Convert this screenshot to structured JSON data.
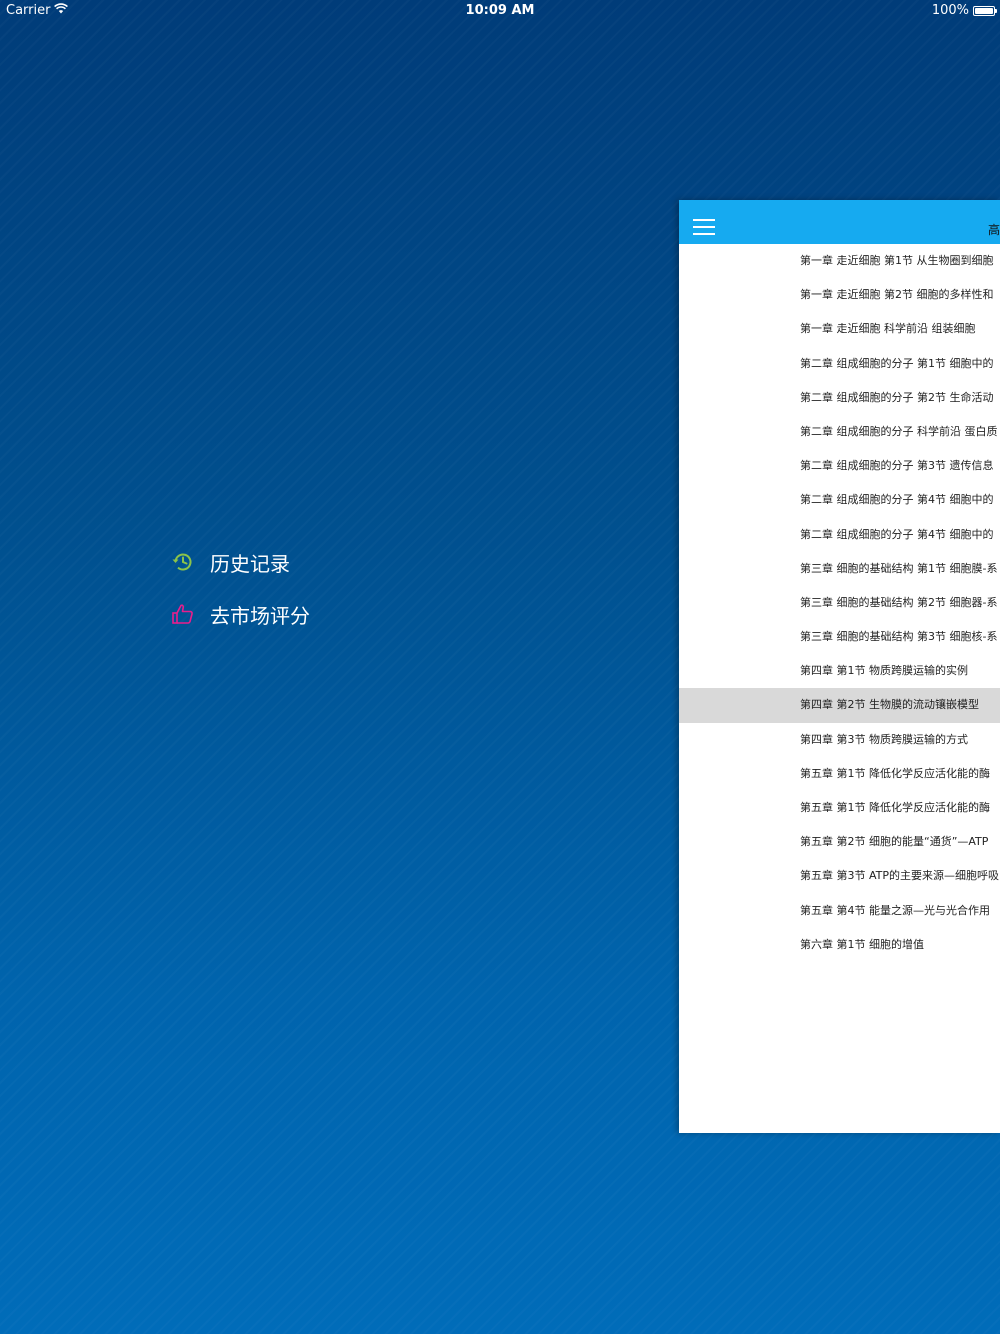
{
  "status_bar": {
    "carrier": "Carrier",
    "time": "10:09 AM",
    "battery_text": "100%",
    "battery_level": 1.0
  },
  "side_menu": {
    "items": [
      {
        "label": "历史记录",
        "icon": "history-icon",
        "icon_color": "#8bc34a"
      },
      {
        "label": "去市场评分",
        "icon": "thumbs-up-icon",
        "icon_color": "#e91e8c"
      }
    ]
  },
  "panel": {
    "header_color": "#16aaf0",
    "title": "高",
    "items": [
      "第一章 走近细胞 第1节 从生物圈到细胞",
      "第一章 走近细胞 第2节 细胞的多样性和",
      "第一章 走近细胞 科学前沿 组装细胞",
      "第二章 组成细胞的分子 第1节 细胞中的",
      "第二章 组成细胞的分子 第2节 生命活动",
      "第二章 组成细胞的分子 科学前沿 蛋白质",
      "第二章 组成细胞的分子 第3节 遗传信息",
      "第二章 组成细胞的分子 第4节 细胞中的",
      "第二章 组成细胞的分子 第4节 细胞中的",
      "第三章 细胞的基础结构 第1节 细胞膜-系",
      "第三章 细胞的基础结构 第2节 细胞器-系",
      "第三章 细胞的基础结构 第3节 细胞核-系",
      "第四章 第1节 物质跨膜运输的实例",
      "第四章 第2节 生物膜的流动镶嵌模型",
      "第四章 第3节 物质跨膜运输的方式",
      "第五章 第1节 降低化学反应活化能的酶",
      "第五章 第1节 降低化学反应活化能的酶",
      "第五章 第2节 细胞的能量“通货”—ATP",
      "第五章 第3节 ATP的主要来源—细胞呼吸",
      "第五章 第4节 能量之源—光与光合作用",
      "第六章 第1节 细胞的增值"
    ],
    "selected_index": 13
  }
}
